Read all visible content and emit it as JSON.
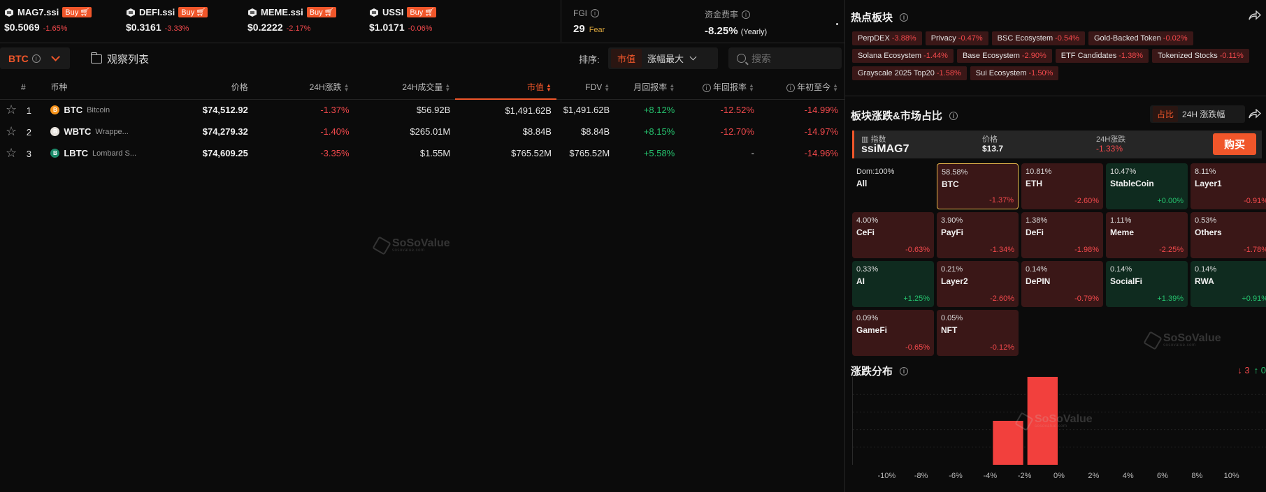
{
  "indices": [
    {
      "name": "MAG7.ssi",
      "buy": "Buy",
      "price": "$0.5069",
      "change": "-1.65%"
    },
    {
      "name": "DEFI.ssi",
      "buy": "Buy",
      "price": "$0.3161",
      "change": "-3.33%"
    },
    {
      "name": "MEME.ssi",
      "buy": "Buy",
      "price": "$0.2222",
      "change": "-2.17%"
    },
    {
      "name": "USSI",
      "buy": "Buy",
      "price": "$1.0171",
      "change": "-0.06%"
    }
  ],
  "fgi": {
    "label": "FGI",
    "value": "29",
    "sentiment": "Fear"
  },
  "funding": {
    "label": "资金费率",
    "value": "-8.25%",
    "suffix": "(Yearly)"
  },
  "toolbar": {
    "coin_tab": "BTC",
    "watchlist": "观察列表",
    "sort_label": "排序:",
    "sort_active": "市值",
    "sort_option": "涨幅最大",
    "search_placeholder": "搜索"
  },
  "table": {
    "headers": [
      "#",
      "币种",
      "价格",
      "24H涨跌",
      "24H成交量",
      "市值",
      "FDV",
      "月回报率",
      "年回报率",
      "年初至今"
    ],
    "rows": [
      {
        "rank": "1",
        "symbol": "BTC",
        "name": "Bitcoin",
        "price": "$74,512.92",
        "change24h": "-1.37%",
        "volume": "$56.92B",
        "mcap": "$1,491.62B",
        "fdv": "$1,491.62B",
        "monthly": "+8.12%",
        "yearly": "-12.52%",
        "ytd": "-14.99%",
        "icon_color": "#f7931a"
      },
      {
        "rank": "2",
        "symbol": "WBTC",
        "name": "Wrappe...",
        "price": "$74,279.32",
        "change24h": "-1.40%",
        "volume": "$265.01M",
        "mcap": "$8.84B",
        "fdv": "$8.84B",
        "monthly": "+8.15%",
        "yearly": "-12.70%",
        "ytd": "-14.97%",
        "icon_color": "#e7e2dc"
      },
      {
        "rank": "3",
        "symbol": "LBTC",
        "name": "Lombard S...",
        "price": "$74,609.25",
        "change24h": "-3.35%",
        "volume": "$1.55M",
        "mcap": "$765.52M",
        "fdv": "$765.52M",
        "monthly": "+5.58%",
        "yearly": "-",
        "ytd": "-14.96%",
        "icon_color": "#1c8a6a"
      }
    ]
  },
  "watermark": {
    "brand": "SoSoValue",
    "domain": "sosovalue.com"
  },
  "hot_sectors": {
    "title": "热点板块",
    "tags": [
      {
        "name": "PerpDEX",
        "change": "-3.88%"
      },
      {
        "name": "Privacy",
        "change": "-0.47%"
      },
      {
        "name": "BSC Ecosystem",
        "change": "-0.54%"
      },
      {
        "name": "Gold-Backed Token",
        "change": "-0.02%"
      },
      {
        "name": "Solana Ecosystem",
        "change": "-1.44%"
      },
      {
        "name": "Base Ecosystem",
        "change": "-2.90%"
      },
      {
        "name": "ETF Candidates",
        "change": "-1.38%"
      },
      {
        "name": "Tokenized Stocks",
        "change": "-0.11%"
      },
      {
        "name": "Grayscale 2025 Top20",
        "change": "-1.58%"
      },
      {
        "name": "Sui Ecosystem",
        "change": "-1.50%"
      }
    ]
  },
  "sector_share": {
    "title": "板块涨跌&市场占比",
    "toggle_on": "占比",
    "toggle_off": "24H 涨跌幅",
    "index_label": "指数",
    "index_name": "ssiMAG7",
    "price_label": "价格",
    "price": "$13.7",
    "change_label": "24H涨跌",
    "change": "-1.33%",
    "buy_button": "购买",
    "cells": [
      {
        "pct": "Dom:100%",
        "name": "All",
        "change": "",
        "tone": "all"
      },
      {
        "pct": "58.58%",
        "name": "BTC",
        "change": "-1.37%",
        "tone": "sel"
      },
      {
        "pct": "10.81%",
        "name": "ETH",
        "change": "-2.60%",
        "tone": "neg"
      },
      {
        "pct": "10.47%",
        "name": "StableCoin",
        "change": "+0.00%",
        "tone": "pos"
      },
      {
        "pct": "8.11%",
        "name": "Layer1",
        "change": "-0.91%",
        "tone": "neg"
      },
      {
        "pct": "4.00%",
        "name": "CeFi",
        "change": "-0.63%",
        "tone": "neg"
      },
      {
        "pct": "3.90%",
        "name": "PayFi",
        "change": "-1.34%",
        "tone": "neg"
      },
      {
        "pct": "1.38%",
        "name": "DeFi",
        "change": "-1.98%",
        "tone": "neg"
      },
      {
        "pct": "1.11%",
        "name": "Meme",
        "change": "-2.25%",
        "tone": "neg"
      },
      {
        "pct": "0.53%",
        "name": "Others",
        "change": "-1.78%",
        "tone": "neg"
      },
      {
        "pct": "0.33%",
        "name": "AI",
        "change": "+1.25%",
        "tone": "pos"
      },
      {
        "pct": "0.21%",
        "name": "Layer2",
        "change": "-2.60%",
        "tone": "neg"
      },
      {
        "pct": "0.14%",
        "name": "DePIN",
        "change": "-0.79%",
        "tone": "neg"
      },
      {
        "pct": "0.14%",
        "name": "SocialFi",
        "change": "+1.39%",
        "tone": "pos"
      },
      {
        "pct": "0.14%",
        "name": "RWA",
        "change": "+0.91%",
        "tone": "pos"
      },
      {
        "pct": "0.09%",
        "name": "GameFi",
        "change": "-0.65%",
        "tone": "neg"
      },
      {
        "pct": "0.05%",
        "name": "NFT",
        "change": "-0.12%",
        "tone": "neg"
      }
    ]
  },
  "distribution": {
    "title": "涨跌分布",
    "down_count": "3",
    "up_count": "0",
    "down_arrow": "↓",
    "up_arrow": "↑"
  },
  "chart_data": {
    "type": "bar",
    "categories": [
      "-10%",
      "-8%",
      "-6%",
      "-4%",
      "-2%",
      "0%",
      "2%",
      "4%",
      "6%",
      "8%",
      "10%"
    ],
    "bins": [
      {
        "range": "-4% ~ -2%",
        "count": 1
      },
      {
        "range": "-2% ~ 0%",
        "count": 2
      }
    ],
    "ylim": [
      0,
      2
    ],
    "grid": true,
    "colors": {
      "down": "#f2403d",
      "up": "#25c26e"
    }
  },
  "colors": {
    "accent": "#f0562a",
    "down": "#f2494c",
    "up": "#25c26e",
    "background": "#0b0b0b"
  }
}
